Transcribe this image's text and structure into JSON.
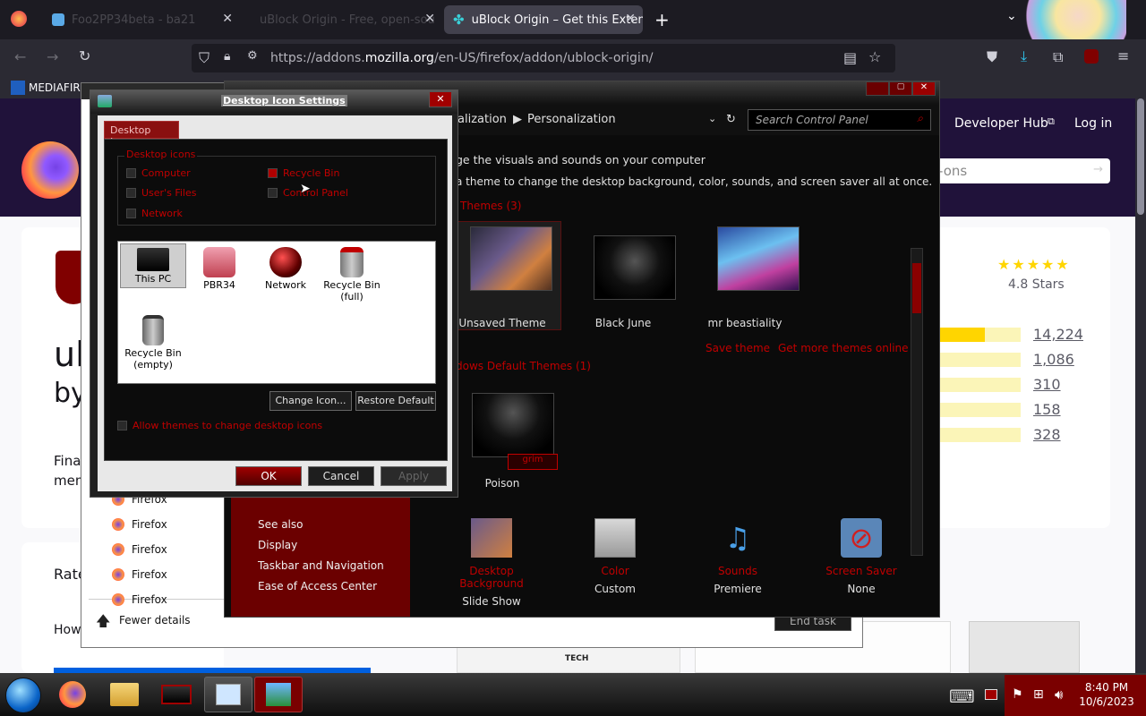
{
  "browser": {
    "tabs": [
      {
        "label": "Foo2PP34beta - ba21"
      },
      {
        "label": "uBlock Origin - Free, open-sou"
      },
      {
        "label": "uBlock Origin – Get this Extensio"
      }
    ],
    "url_prefix": "https://addons.",
    "url_domain": "mozilla.org",
    "url_path": "/en-US/firefox/addon/ublock-origin/",
    "bookmark": "MEDIAFIRE"
  },
  "amo": {
    "developer_hub": "Developer Hub",
    "login": "Log in",
    "search_placeholder": "-ons",
    "rating": "4.8 Stars",
    "counts": [
      "14,224",
      "1,086",
      "310",
      "158",
      "328"
    ],
    "count_fill": [
      0.6,
      0.05,
      0.02,
      0.01,
      0.02
    ],
    "title_fragment": "ul",
    "by_fragment": "by",
    "desc_fragment_1": "Fina",
    "desc_fragment_2": "mem",
    "rate_fragment": "Rate",
    "how_fragment": "How",
    "tech_label": "TECH"
  },
  "taskmgr": {
    "items": [
      "Firefox",
      "Firefox",
      "Firefox",
      "Firefox",
      "Firefox"
    ],
    "fewer_details": "Fewer details",
    "end_task": "End task"
  },
  "cpanel": {
    "crumb1": "alization",
    "crumb2": "Personalization",
    "search_placeholder": "Search Control Panel",
    "intro": "ge the visuals and sounds on your computer",
    "intro2": "a theme to change the desktop background, color, sounds, and screen saver all at once.",
    "my_themes": "Themes (3)",
    "themes": [
      "Unsaved Theme",
      "Black June",
      "mr beastiality"
    ],
    "save_theme": "Save theme",
    "get_more": "Get more themes online",
    "default_themes": "dows Default Themes (1)",
    "default_theme": "Poison",
    "see_also": "See also",
    "sidebar": [
      "Display",
      "Taskbar and Navigation",
      "Ease of Access Center"
    ],
    "bottom": [
      {
        "title": "Desktop Background",
        "value": "Slide Show"
      },
      {
        "title": "Color",
        "value": "Custom"
      },
      {
        "title": "Sounds",
        "value": "Premiere"
      },
      {
        "title": "Screen Saver",
        "value": "None"
      }
    ]
  },
  "dialog": {
    "title": "Desktop Icon Settings",
    "close": "✕",
    "tab": "Desktop Icons",
    "group": "Desktop icons",
    "checks": [
      {
        "label": "Computer",
        "checked": false
      },
      {
        "label": "Recycle Bin",
        "checked": true
      },
      {
        "label": "User's Files",
        "checked": false
      },
      {
        "label": "Control Panel",
        "checked": false
      },
      {
        "label": "Network",
        "checked": false
      }
    ],
    "icons": [
      {
        "label": "This PC"
      },
      {
        "label": "PBR34"
      },
      {
        "label": "Network"
      },
      {
        "label": "Recycle Bin (full)"
      },
      {
        "label": "Recycle Bin (empty)"
      }
    ],
    "change_icon": "Change Icon...",
    "restore_default": "Restore Default",
    "allow_themes": "Allow themes to change desktop icons",
    "ok": "OK",
    "cancel": "Cancel",
    "apply": "Apply"
  },
  "taskbar": {
    "time": "8:40 PM",
    "date": "10/6/2023"
  }
}
